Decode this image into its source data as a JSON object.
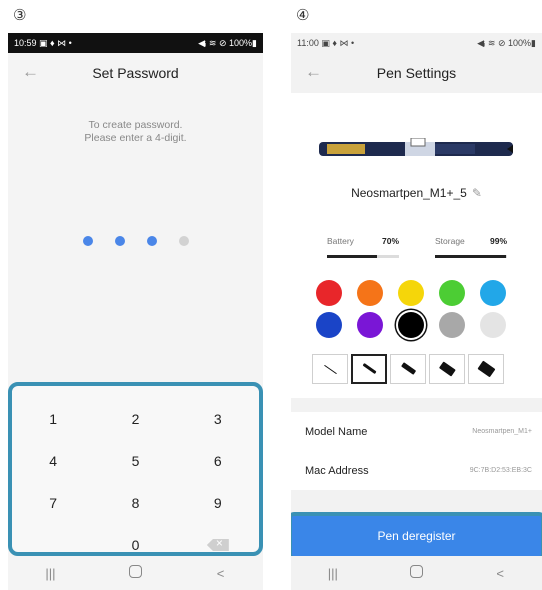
{
  "steps": {
    "left": "③",
    "right": "④"
  },
  "set_password": {
    "status": {
      "time": "10:59",
      "left_icons": "▣ ♦ ⋈ •",
      "right_icons": "◀ᵢ ≋ ⊘ 100%▮"
    },
    "title": "Set Password",
    "back_icon": "←",
    "prompt_line1": "To create password.",
    "prompt_line2": "Please enter a 4-digit.",
    "pin_filled": 3,
    "pin_length": 4,
    "keys": [
      "1",
      "2",
      "3",
      "4",
      "5",
      "6",
      "7",
      "8",
      "9",
      "",
      "0",
      "backspace"
    ],
    "nav": {
      "recents": "|||",
      "back": "<"
    }
  },
  "pen_settings": {
    "status": {
      "time": "11:00",
      "left_icons": "▣ ♦ ⋈ •",
      "right_icons": "◀ᵢ ≋ ⊘ 100%▮"
    },
    "title": "Pen Settings",
    "back_icon": "←",
    "pen_name": "Neosmartpen_M1+_5",
    "edit_icon": "✎",
    "battery": {
      "label": "Battery",
      "value": "70%",
      "level": 0.7
    },
    "storage": {
      "label": "Storage",
      "value": "99%",
      "level": 0.99
    },
    "colors": [
      "#e8262a",
      "#f57418",
      "#f5d60a",
      "#4ccd34",
      "#22a7e8",
      "#1a44c7",
      "#7a16d6",
      "#000000",
      "#a8a8a8",
      "#e4e4e4"
    ],
    "selected_color_index": 7,
    "thickness_levels": [
      1,
      2,
      3,
      4,
      5
    ],
    "selected_thickness_index": 1,
    "model_name_label": "Model Name",
    "model_name_value": "Neosmartpen_M1+",
    "mac_label": "Mac Address",
    "mac_value": "9C:7B:D2:53:EB:3C",
    "deregister_label": "Pen deregister",
    "nav": {
      "recents": "|||",
      "back": "<"
    }
  }
}
